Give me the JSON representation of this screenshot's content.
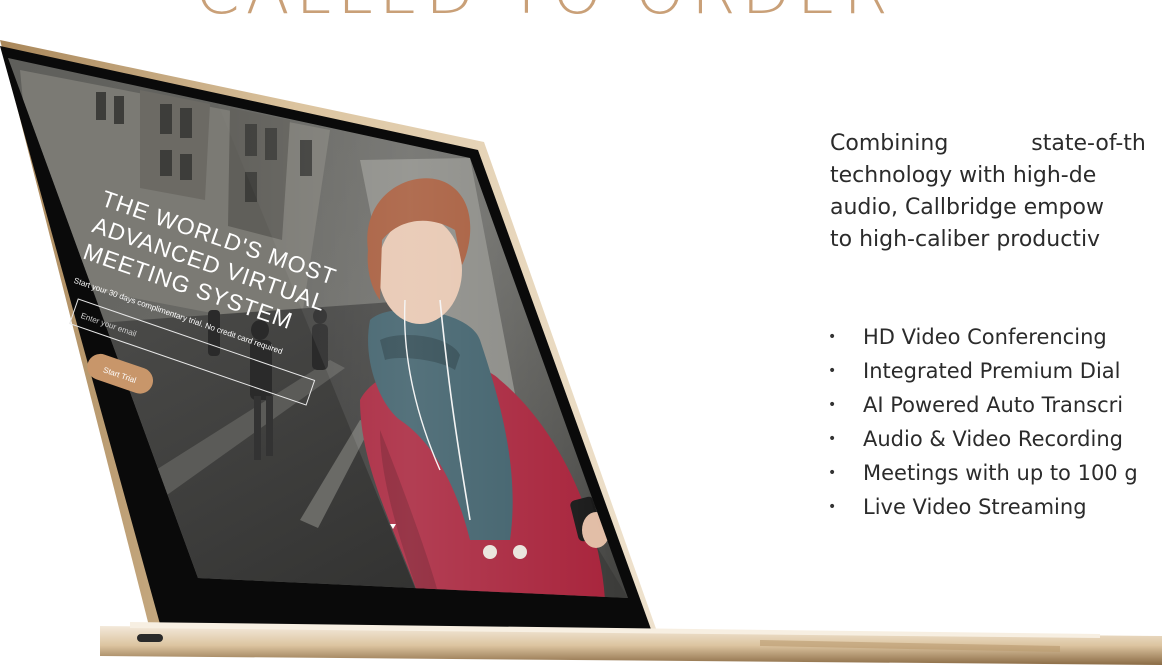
{
  "heading": "CALLED TO ORDER",
  "screen": {
    "hero_lines": [
      "THE WORLD'S MOST",
      "ADVANCED VIRTUAL",
      "MEETING SYSTEM"
    ],
    "subtitle": "Start your 30 days complimentary trial. No credit card required",
    "email_placeholder": "Enter your email",
    "cta_label": "Start Trial"
  },
  "intro_lines": [
    "Combining state-of-th",
    "technology with high-de",
    "audio, Callbridge empow",
    "to high-caliber productiv"
  ],
  "features": [
    "HD Video Conferencing",
    "Integrated Premium Dial",
    "AI Powered Auto Transcri",
    "Audio & Video Recording",
    "Meetings with up to 100 g",
    "Live Video Streaming"
  ],
  "colors": {
    "accent": "#c9a078",
    "cta": "#c8966a",
    "text": "#2b2b2b",
    "coat": "#a8243c",
    "scarf": "#3e5f6a"
  }
}
